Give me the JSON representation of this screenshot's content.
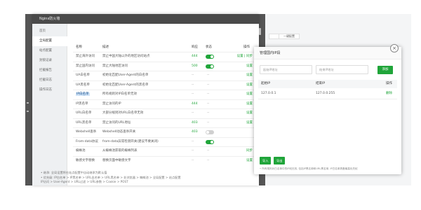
{
  "main_dialog": {
    "title": "Nginx防火墙"
  },
  "sidebar": {
    "items": [
      {
        "label": "首页",
        "active": false
      },
      {
        "label": "全局配置",
        "active": true
      },
      {
        "label": "站点配置",
        "active": false
      },
      {
        "label": "封锁记录",
        "active": false
      },
      {
        "label": "拦截报告",
        "active": false
      },
      {
        "label": "拦截日志",
        "active": false
      },
      {
        "label": "操作日志",
        "active": false
      }
    ]
  },
  "table": {
    "headers": {
      "name": "名称",
      "desc": "描述",
      "count": "响应",
      "status": "状态",
      "ops": "操作"
    },
    "rows": [
      {
        "name": "禁止海外访问",
        "desc": "禁止中国大陆以外的地区访问站点",
        "count": "444",
        "count_on": true,
        "toggle": "on",
        "op": "设置 | 同步",
        "highlight": false
      },
      {
        "name": "禁止国内访问",
        "desc": "禁止大陆地区访问",
        "count": "500",
        "count_on": true,
        "toggle": "on",
        "op": "设置",
        "highlight": false
      },
      {
        "name": "UA白名单",
        "desc": "初始化匹配User-Agent的白名单",
        "count": "--",
        "count_on": false,
        "toggle": "none",
        "op": "设置",
        "highlight": false
      },
      {
        "name": "UA黑名单",
        "desc": "初始化匹配User-Agent的黑名单",
        "count": "--",
        "count_on": false,
        "toggle": "none",
        "op": "设置",
        "highlight": false
      },
      {
        "name": "IP白名单",
        "desc": "所有规则对IP白名单无效",
        "count": "--",
        "count_on": false,
        "toggle": "none",
        "op": "设置",
        "highlight": true
      },
      {
        "name": "IP黑名单",
        "desc": "禁止访问的IP",
        "count": "444",
        "count_on": true,
        "toggle": "none",
        "op": "设置",
        "highlight": false
      },
      {
        "name": "URL白名单",
        "desc": "大部分规则对URL白名单无效",
        "count": "--",
        "count_on": false,
        "toggle": "none",
        "op": "设置",
        "highlight": false
      },
      {
        "name": "URL黑名单",
        "desc": "禁止访问的URL地址",
        "count": "403",
        "count_on": true,
        "toggle": "none",
        "op": "设置",
        "highlight": false
      },
      {
        "name": "Webshell查杀",
        "desc": "Webshell动态查杀开关",
        "count": "403",
        "count_on": true,
        "toggle": "off",
        "op": "",
        "highlight": false
      },
      {
        "name": "From-data协议",
        "desc": "from-data异常检测开关(建议不要关闭)",
        "count": "--",
        "count_on": false,
        "toggle": "on",
        "op": "",
        "highlight": false
      },
      {
        "name": "蜘蛛池",
        "desc": "从蜘蛛池获取的蜘蛛列表",
        "count": "--",
        "count_on": false,
        "toggle": "none",
        "op": "同步",
        "highlight": false
      },
      {
        "name": "敏感文字替换",
        "desc": "替换页面中敏感文字",
        "count": "--",
        "count_on": false,
        "toggle": "none",
        "op": "设置",
        "highlight": false
      }
    ]
  },
  "notes": [
    "• 继承: 全局设置将在站点配置中自动继承为默认值",
    "• 优先级: IP白名单 > IP黑名单 > URL白名单 > URL黑名单 > 非浏览器 > 蜘蛛池 > 全局配置 > 站点配置",
    "  IP访问 > User-Agent > URL过滤 > URL参数 > Cookie > POST"
  ],
  "bg_page": {
    "button_label": "一键配置"
  },
  "ip_dialog": {
    "title": "管理国内IP段",
    "start_placeholder": "起始IP地址",
    "end_placeholder": "结束IP地址",
    "add_label": "添加",
    "headers": {
      "start": "起始IP",
      "end": "结束IP",
      "ops": "操作"
    },
    "rows": [
      {
        "start": "127.0.0.1",
        "end": "127.0.0.255",
        "op": "删除"
      }
    ],
    "import_label": "导入",
    "export_label": "导出",
    "note": "• 所有规则对白名单中的IP段无效, 包括IP黑名单和URL黑名单, IP白名单具备最高优先权"
  },
  "colors": {
    "accent": "#20a53a",
    "highlight": "#cfe3f7"
  }
}
